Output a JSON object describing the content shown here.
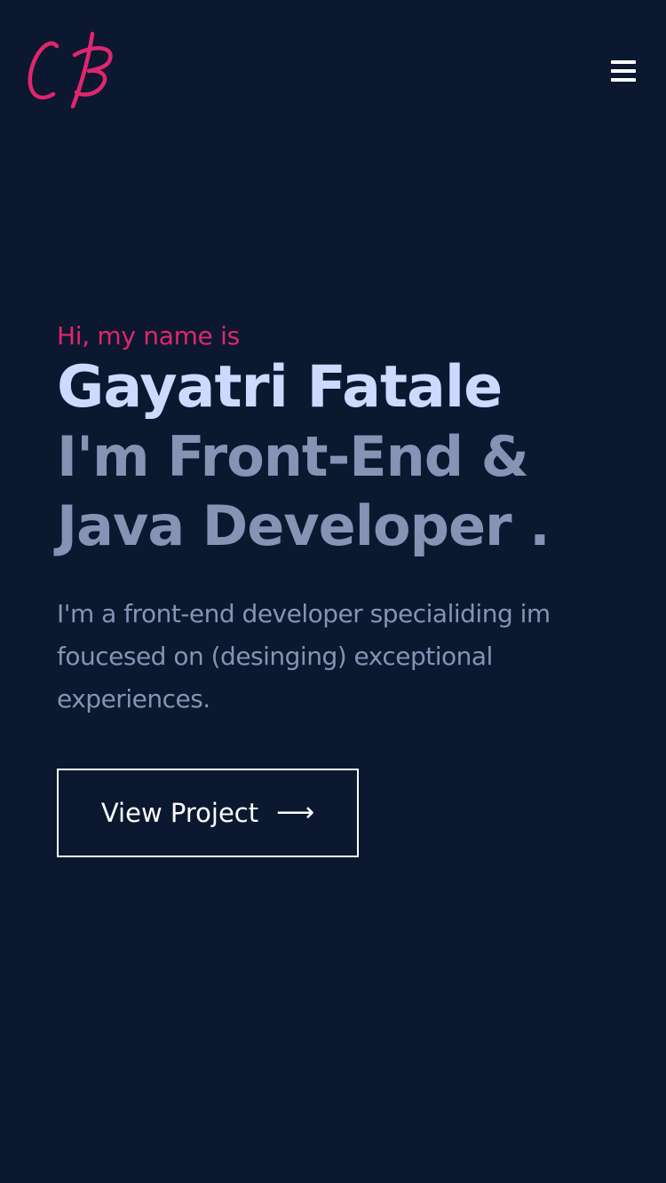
{
  "header": {
    "logo_text": "CB",
    "menu_icon": "hamburger-menu-icon"
  },
  "hero": {
    "greeting": "Hi, my name is",
    "name": "Gayatri Fatale",
    "role_line1": "I'm Front-End &",
    "role_line2": "Java Developer .",
    "description": "I'm a front-end developer specialiding im foucesed on (desinging) exceptional experiences.",
    "cta_label": "View Project",
    "cta_icon": "arrow-right-icon"
  },
  "colors": {
    "background": "#0b1830",
    "accent": "#e0266e",
    "name": "#cfd9ff",
    "muted": "#8892b4",
    "button": "#ffffff"
  }
}
